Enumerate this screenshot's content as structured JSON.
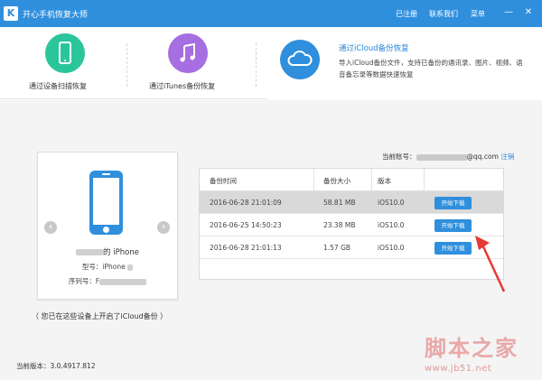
{
  "app": {
    "logo_letter": "K",
    "title": "开心手机恢复大师"
  },
  "titlebar": {
    "registered": "已注册",
    "contact": "联系我们",
    "menu": "菜单",
    "minimize": "—",
    "close": "✕"
  },
  "modes": [
    {
      "label": "通过设备扫描恢复",
      "icon": "phone-icon",
      "color": "#2bc59b"
    },
    {
      "label": "通过iTunes备份恢复",
      "icon": "music-note-icon",
      "color": "#a66ee0"
    },
    {
      "label": "通过iCloud备份恢复",
      "icon": "cloud-icon",
      "color": "#2f8fdd",
      "active": true,
      "description": "导入iCloud备份文件，支持已备份的通讯录、图片、视频、语音备忘录等数据快速恢复"
    }
  ],
  "account": {
    "label": "当前账号：",
    "email_suffix": "@qq.com",
    "logout": "注销"
  },
  "device": {
    "name_suffix": "的 iPhone",
    "model_label": "型号：iPhone",
    "serial_label": "序列号：F"
  },
  "caption": "（ 您已在这些设备上开启了iCloud备份 ）",
  "table": {
    "headers": [
      "备份时间",
      "备份大小",
      "版本"
    ],
    "rows": [
      {
        "time": "2016-06-28 21:01:09",
        "size": "58.81 MB",
        "version": "iOS10.0",
        "action": "开始下载",
        "selected": true
      },
      {
        "time": "2016-06-25 14:50:23",
        "size": "23.38 MB",
        "version": "iOS10.0",
        "action": "开始下载"
      },
      {
        "time": "2016-06-28 21:01:13",
        "size": "1.57 GB",
        "version": "iOS10.0",
        "action": "开始下载"
      }
    ]
  },
  "version": "当前版本：3.0.4917.812",
  "watermark": {
    "text": "脚本之家",
    "url": "www.jb51.net"
  },
  "colors": {
    "brand": "#2f8fdd",
    "annotation": "#e53935"
  }
}
